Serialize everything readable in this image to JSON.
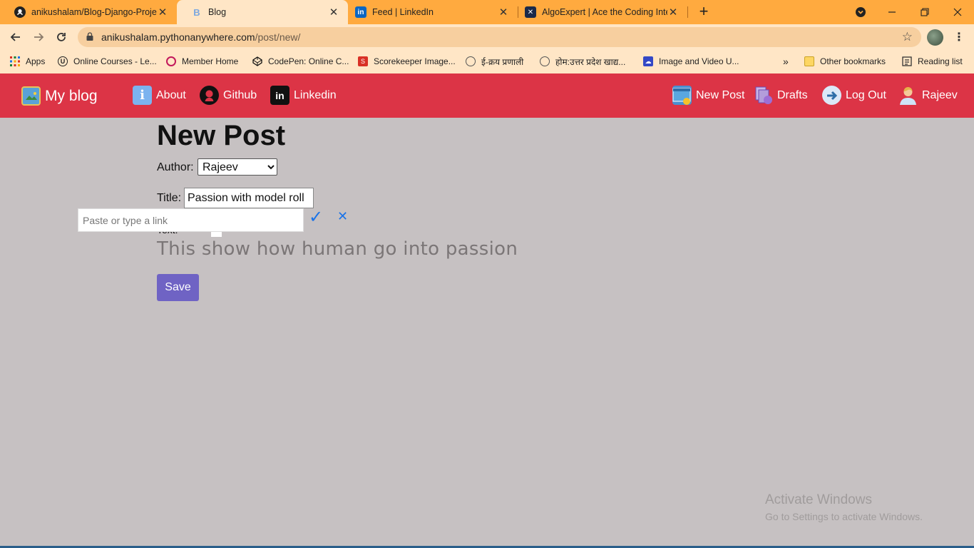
{
  "browser": {
    "tabs": [
      {
        "title": "anikushalam/Blog-Django-Project",
        "favicon": "github-icon",
        "active": false
      },
      {
        "title": "Blog",
        "favicon": "blog-favicon",
        "active": true
      },
      {
        "title": "Feed | LinkedIn",
        "favicon": "linkedin-icon",
        "active": false
      },
      {
        "title": "AlgoExpert | Ace the Coding Interview",
        "favicon": "algoexpert-icon",
        "active": false
      }
    ],
    "url_host": "anikushalam.pythonanywhere.com",
    "url_path": "/post/new/",
    "bookmarks": [
      {
        "label": "Apps",
        "icon": "apps-grid-icon"
      },
      {
        "label": "Online Courses - Le...",
        "icon": "udemy-icon"
      },
      {
        "label": "Member Home",
        "icon": "member-icon"
      },
      {
        "label": "CodePen: Online C...",
        "icon": "codepen-icon"
      },
      {
        "label": "Scorekeeper Image...",
        "icon": "scorekeeper-icon"
      },
      {
        "label": "ई-क्रय प्रणाली",
        "icon": "emblem-icon"
      },
      {
        "label": "होम:उत्तर प्रदेश खाद्य...",
        "icon": "emblem-icon"
      },
      {
        "label": "Image and Video U...",
        "icon": "cloud-icon"
      }
    ],
    "other_bookmarks": "Other bookmarks",
    "reading_list": "Reading list",
    "overflow": "»"
  },
  "site": {
    "brand": "My blog",
    "left_links": [
      {
        "label": "About",
        "icon": "info-icon"
      },
      {
        "label": "Github",
        "icon": "github-icon"
      },
      {
        "label": "Linkedin",
        "icon": "linkedin-icon"
      }
    ],
    "right_links": [
      {
        "label": "New Post",
        "icon": "new-post-icon"
      },
      {
        "label": "Drafts",
        "icon": "drafts-icon"
      },
      {
        "label": "Log Out",
        "icon": "logout-icon"
      },
      {
        "label": "Rajeev",
        "icon": "user-avatar-icon"
      }
    ]
  },
  "form": {
    "heading": "New Post",
    "author_label": "Author:",
    "author_value": "Rajeev",
    "title_label": "Title:",
    "title_value": "Passion with model roll",
    "text_label": "Text:",
    "link_placeholder": "Paste or type a link",
    "body_text": "This show how human go into passion",
    "save_label": "Save"
  },
  "watermark": {
    "line1": "Activate Windows",
    "line2": "Go to Settings to activate Windows."
  },
  "colors": {
    "navbar": "#dc3446",
    "page_bg": "#c6c1c2",
    "save_button": "#6f63c4",
    "tabstrip": "#ffaa3f"
  }
}
